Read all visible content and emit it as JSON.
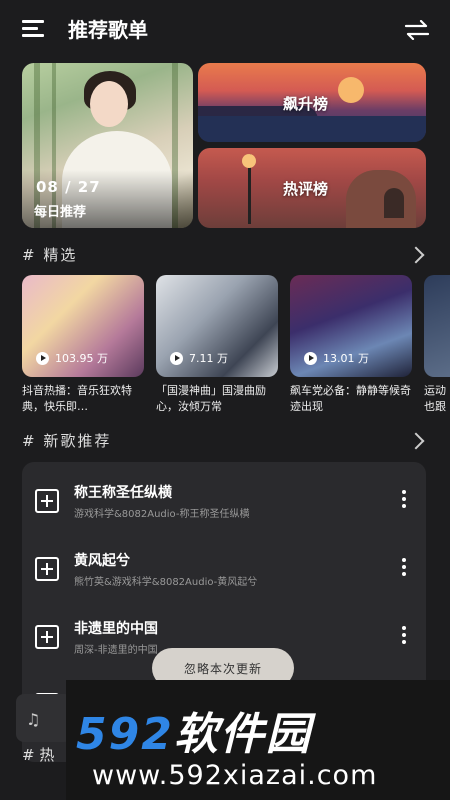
{
  "header": {
    "title": "推荐歌单",
    "menu_icon": "menu-icon",
    "shuffle_icon": "shuffle-icon"
  },
  "top_cards": {
    "daily": {
      "date": "08 / 27",
      "label": "每日推荐"
    },
    "rising": {
      "label": "飙升榜"
    },
    "hot": {
      "label": "热评榜"
    }
  },
  "featured": {
    "heading": "# 精选",
    "items": [
      {
        "count": "103.95 万",
        "title": "抖音热播：音乐狂欢特典，快乐即…"
      },
      {
        "count": "7.11 万",
        "title": "「国漫神曲」国漫曲励心，汝倾万常"
      },
      {
        "count": "13.01 万",
        "title": "飙车党必备：静静等候奇迹出现"
      },
      {
        "count": "",
        "title": "运动也跟"
      }
    ]
  },
  "new_songs": {
    "heading": "# 新歌推荐",
    "items": [
      {
        "name": "称王称圣任纵横",
        "artist": "游戏科学&8082Audio-称王称圣任纵横"
      },
      {
        "name": "黄风起兮",
        "artist": "熊竹英&游戏科学&8082Audio-黄风起兮"
      },
      {
        "name": "非遗里的中国",
        "artist": "周深-非遗里的中国"
      }
    ]
  },
  "toast": {
    "ignore_update": "忽略本次更新"
  },
  "hidden_section": {
    "heading": "# 热"
  },
  "watermark": {
    "brand_num": "592",
    "brand_cn": "软件园",
    "url": "www.592xiazai.com"
  },
  "colors": {
    "background": "#1c1c1e",
    "panel": "#2a2a2d",
    "watermark_blue": "#2f86e6"
  }
}
